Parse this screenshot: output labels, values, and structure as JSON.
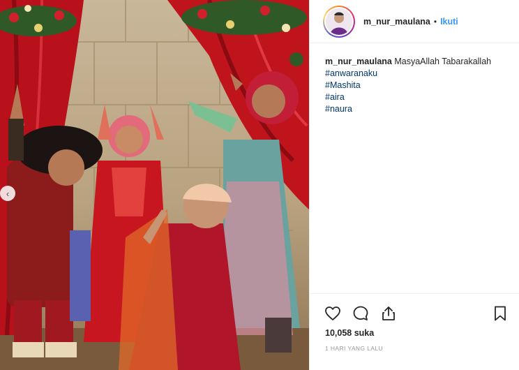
{
  "post": {
    "username": "m_nur_maulana",
    "follow_label": "Ikuti",
    "separator": "•",
    "caption_text": "MasyaAllah Tabarakallah",
    "hashtags": [
      "#anwaranaku",
      "#Mashita",
      "#aira",
      "#naura"
    ],
    "likes_text": "10,058 suka",
    "time_text": "1 HARI YANG LALU"
  },
  "icons": {
    "like": "heart-icon",
    "comment": "comment-icon",
    "share": "share-icon",
    "save": "bookmark-icon",
    "prev": "chevron-left-icon"
  },
  "colors": {
    "link": "#003569",
    "follow": "#3897f0",
    "curtain": "#c0141c"
  }
}
